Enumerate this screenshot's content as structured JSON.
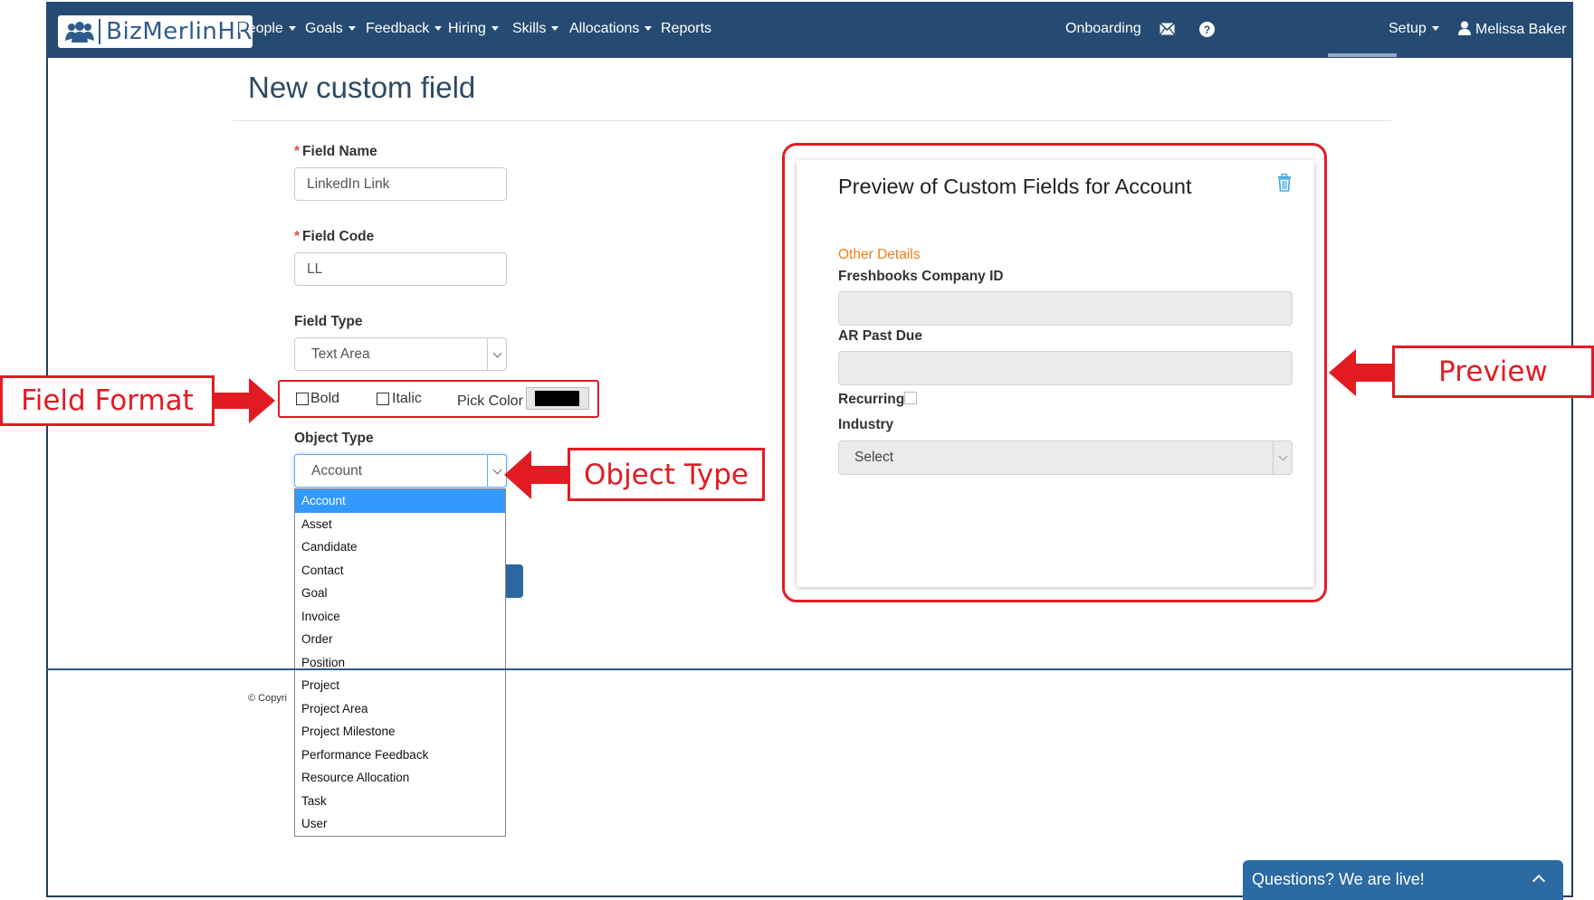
{
  "nav": {
    "brand": "BizMerlinHR",
    "items": [
      {
        "label": "People",
        "dropdown": true
      },
      {
        "label": "Goals",
        "dropdown": true
      },
      {
        "label": "Feedback",
        "dropdown": true
      },
      {
        "label": "Hiring",
        "dropdown": true
      },
      {
        "label": "Skills",
        "dropdown": true
      },
      {
        "label": "Allocations",
        "dropdown": true
      },
      {
        "label": "Reports",
        "dropdown": false
      }
    ],
    "onboarding": "Onboarding",
    "setup": "Setup",
    "user": "Melissa Baker"
  },
  "page": {
    "title": "New custom field"
  },
  "form": {
    "field_name": {
      "label": "Field Name",
      "value": "LinkedIn Link",
      "required": true
    },
    "field_code": {
      "label": "Field Code",
      "value": "LL",
      "required": true
    },
    "field_type": {
      "label": "Field Type",
      "value": "Text Area"
    },
    "format": {
      "bold": "Bold",
      "italic": "Italic",
      "pick_color": "Pick Color",
      "color": "#000000"
    },
    "object_type": {
      "label": "Object Type",
      "value": "Account",
      "options": [
        "Account",
        "Asset",
        "Candidate",
        "Contact",
        "Goal",
        "Invoice",
        "Order",
        "Position",
        "Project",
        "Project Area",
        "Project Milestone",
        "Performance Feedback",
        "Resource Allocation",
        "Task",
        "User"
      ],
      "selected_index": 0
    }
  },
  "footer": {
    "copyright": "© Copyri"
  },
  "preview": {
    "title": "Preview of Custom Fields for Account",
    "section": "Other Details",
    "fields": {
      "freshbooks": "Freshbooks Company ID",
      "ar_past_due": "AR Past Due",
      "recurring": "Recurring",
      "industry": "Industry",
      "industry_value": "Select"
    }
  },
  "callouts": {
    "field_format": "Field Format",
    "object_type": "Object Type",
    "preview": "Preview"
  },
  "chat": {
    "label": "Questions? We are live!"
  },
  "colors": {
    "navbar": "#254b73",
    "callout_red": "#e21b23",
    "section_orange": "#f07f1b",
    "selected_blue": "#3399ff"
  }
}
